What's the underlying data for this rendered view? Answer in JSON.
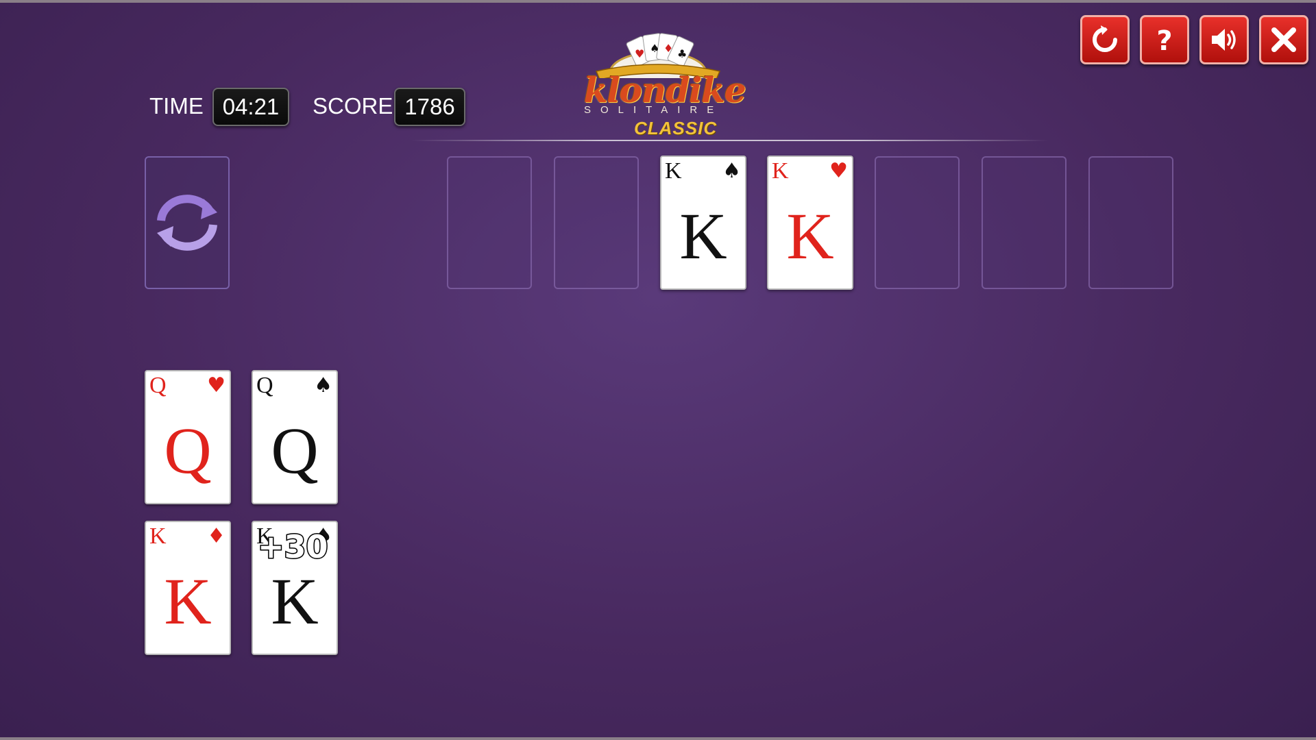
{
  "hud": {
    "time_label": "TIME",
    "time_value": "04:21",
    "score_label": "SCORE",
    "score_value": "1786"
  },
  "logo": {
    "title": "klondike",
    "subtitle": "SOLITAIRE",
    "edition": "CLASSIC"
  },
  "toolbar": {
    "buttons": [
      "restart-icon",
      "help-icon",
      "sound-icon",
      "close-icon"
    ],
    "button_color": "#d01a14"
  },
  "foundation_cards": [
    {
      "rank": "K",
      "suit": "♠",
      "color": "black"
    },
    {
      "rank": "K",
      "suit": "♥",
      "color": "red"
    }
  ],
  "tableau_cards": [
    {
      "rank": "Q",
      "suit": "♥",
      "color": "red"
    },
    {
      "rank": "Q",
      "suit": "♠",
      "color": "black"
    },
    {
      "rank": "K",
      "suit": "♦",
      "color": "red"
    },
    {
      "rank": "K",
      "suit": "♠",
      "color": "black"
    }
  ],
  "bonus_popup": "+30",
  "colors": {
    "background": "#48295f",
    "card_red": "#e0231c",
    "card_black": "#111111"
  }
}
